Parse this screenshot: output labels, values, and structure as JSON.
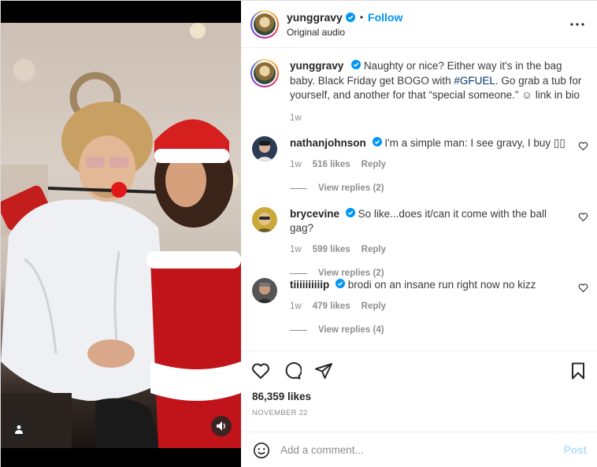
{
  "post": {
    "author": "yunggravy",
    "follow_label": "Follow",
    "audio": "Original audio",
    "separator": "•"
  },
  "caption": {
    "username": "yunggravy",
    "text_before": "Naughty or nice? Either way it's in the bag baby. Black Friday get BOGO with ",
    "hashtag": "#GFUEL",
    "text_after": ". Go grab a tub for yourself, and another for that “special someone.” ☺ link in bio",
    "time": "1w"
  },
  "comments": [
    {
      "username": "nathanjohnson",
      "text": "I'm a simple man: I see gravy, I buy ▯▯",
      "time": "1w",
      "likes": "516 likes",
      "reply": "Reply",
      "view_replies": "View replies (2)",
      "avatar_color": "#2b3a55"
    },
    {
      "username": "brycevine",
      "text": "So like...does it/can it come with the ball gag?",
      "time": "1w",
      "likes": "599 likes",
      "reply": "Reply",
      "view_replies": "View replies (2)",
      "avatar_color": "#c9a93a"
    },
    {
      "username": "tiiiiiiiiiip",
      "text": "brodi on an insane run right now no kizz",
      "time": "1w",
      "likes": "479 likes",
      "reply": "Reply",
      "view_replies": "View replies (4)",
      "avatar_color": "#555555"
    }
  ],
  "stats": {
    "likes": "86,359 likes",
    "date": "NOVEMBER 22"
  },
  "composer": {
    "placeholder": "Add a comment...",
    "post_label": "Post"
  },
  "icons": {
    "verified": "verified-badge-icon",
    "more": "more-options-icon",
    "heart": "heart-icon",
    "comment": "comment-icon",
    "share": "share-icon",
    "save": "bookmark-icon",
    "emoji": "emoji-icon",
    "tag": "user-tag-icon",
    "sound": "sound-icon"
  },
  "colors": {
    "link_blue": "#0095f6",
    "hashtag": "#00376b",
    "muted": "#8e8e8e",
    "post_disabled": "#b2dffc"
  }
}
